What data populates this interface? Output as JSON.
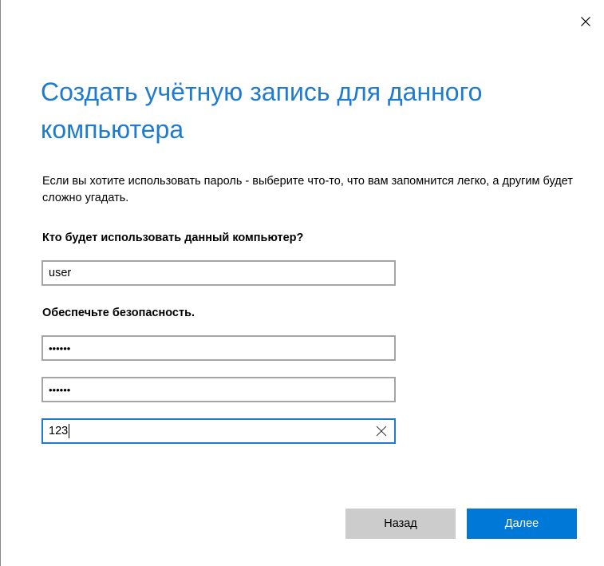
{
  "dialog": {
    "title": "Создать учётную запись для данного компьютера",
    "description": "Если вы хотите использовать пароль - выберите что-то, что вам запомнится легко, а другим будет сложно угадать.",
    "close_icon": "close-icon"
  },
  "user_section": {
    "label": "Кто будет использовать данный компьютер?",
    "username_value": "user"
  },
  "security_section": {
    "label": "Обеспечьте безопасность.",
    "password_value": "••••••",
    "confirm_password_value": "••••••",
    "hint_value": "123",
    "hint_clear_icon": "clear-icon"
  },
  "buttons": {
    "back_label": "Назад",
    "next_label": "Далее"
  },
  "colors": {
    "accent": "#0078d7",
    "title": "#1f7bd0",
    "field_border": "#a5a5a5",
    "back_button": "#cccccc"
  }
}
